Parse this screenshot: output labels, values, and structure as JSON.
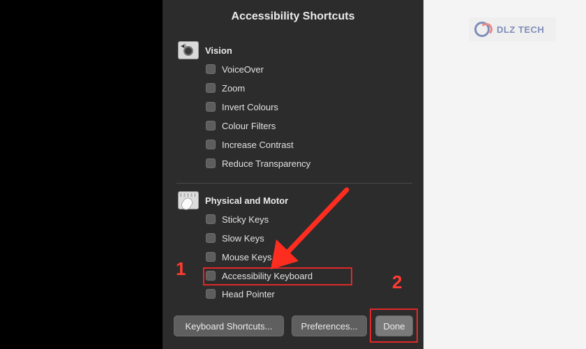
{
  "dialog": {
    "title": "Accessibility Shortcuts",
    "sections": [
      {
        "title": "Vision",
        "icon": "accessibility-vision-icon",
        "options": [
          {
            "label": "VoiceOver",
            "checked": false
          },
          {
            "label": "Zoom",
            "checked": false
          },
          {
            "label": "Invert Colours",
            "checked": false
          },
          {
            "label": "Colour Filters",
            "checked": false
          },
          {
            "label": "Increase Contrast",
            "checked": false
          },
          {
            "label": "Reduce Transparency",
            "checked": false
          }
        ]
      },
      {
        "title": "Physical and Motor",
        "icon": "keyboard-mouse-icon",
        "options": [
          {
            "label": "Sticky Keys",
            "checked": false
          },
          {
            "label": "Slow Keys",
            "checked": false
          },
          {
            "label": "Mouse Keys",
            "checked": false
          },
          {
            "label": "Accessibility Keyboard",
            "checked": false
          },
          {
            "label": "Head Pointer",
            "checked": false
          }
        ]
      }
    ],
    "buttons": {
      "keyboard_shortcuts": "Keyboard Shortcuts...",
      "preferences": "Preferences...",
      "done": "Done"
    }
  },
  "annotations": {
    "step1": "1",
    "step2": "2",
    "color": "#e0282a"
  },
  "watermark": {
    "text": "DLZ TECH"
  }
}
